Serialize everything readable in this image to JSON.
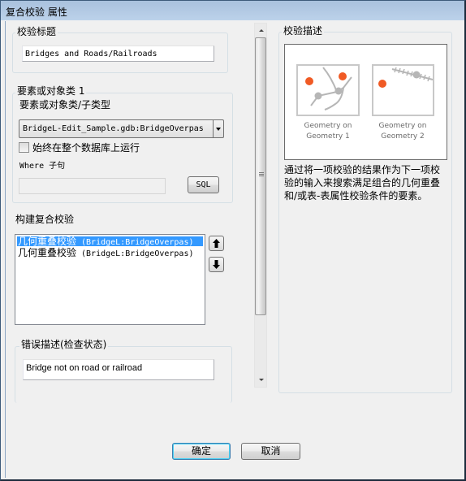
{
  "window": {
    "title": "复合校验 属性"
  },
  "check_title": {
    "group_label": "校验标题",
    "value": "Bridges and Roads/Railroads"
  },
  "feature_class": {
    "group_label": "要素或对象类 1",
    "subtype_label": "要素或对象类/子类型",
    "selected": "BridgeL-Edit_Sample.gdb:BridgeOverpas",
    "always_run_label": "始终在整个数据库上运行",
    "always_run_checked": false,
    "where_label": "Where 子句",
    "where_value": "",
    "sql_button": "SQL"
  },
  "build_composite": {
    "label": "构建复合校验",
    "items": [
      {
        "name": "几何重叠校验",
        "detail": "(BridgeL:BridgeOverpas)",
        "selected": true
      },
      {
        "name": "几何重叠校验",
        "detail": "(BridgeL:BridgeOverpas)",
        "selected": false
      }
    ],
    "move_up_icon": "arrow-up-icon",
    "move_down_icon": "arrow-down-icon"
  },
  "error_description": {
    "group_label": "错误描述(检查状态)",
    "value": "Bridge not on road or railroad"
  },
  "check_description": {
    "group_label": "校验描述",
    "captions": [
      {
        "line1": "Geometry on",
        "line2": "Geometry 1"
      },
      {
        "line1": "Geometry on",
        "line2": "Geometry 2"
      }
    ],
    "text_lines": [
      "通过将一项校验的结果作为下一项校",
      "验的输入来搜索满足组合的几何重叠",
      "和/或表-表属性校验条件的要素。"
    ],
    "accent_color": "#f05a24"
  },
  "footer": {
    "ok_button": "确定",
    "cancel_button": "取消"
  }
}
